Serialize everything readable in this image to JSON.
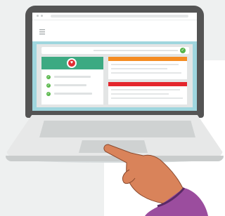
{
  "colors": {
    "lid": "#545454",
    "screen": "#9fd6de",
    "green_header": "#3caa82",
    "check_green": "#5bb84d",
    "heart_red": "#e22d33",
    "orange_bar": "#f58c22",
    "red_bar": "#e4262d",
    "skin": "#d9835a",
    "sleeve": "#9b4d9e"
  },
  "icons": {
    "menu": "hamburger-icon",
    "status": "check-circle-icon",
    "health": "heart-pulse-icon",
    "list_check": "check-circle-icon"
  }
}
